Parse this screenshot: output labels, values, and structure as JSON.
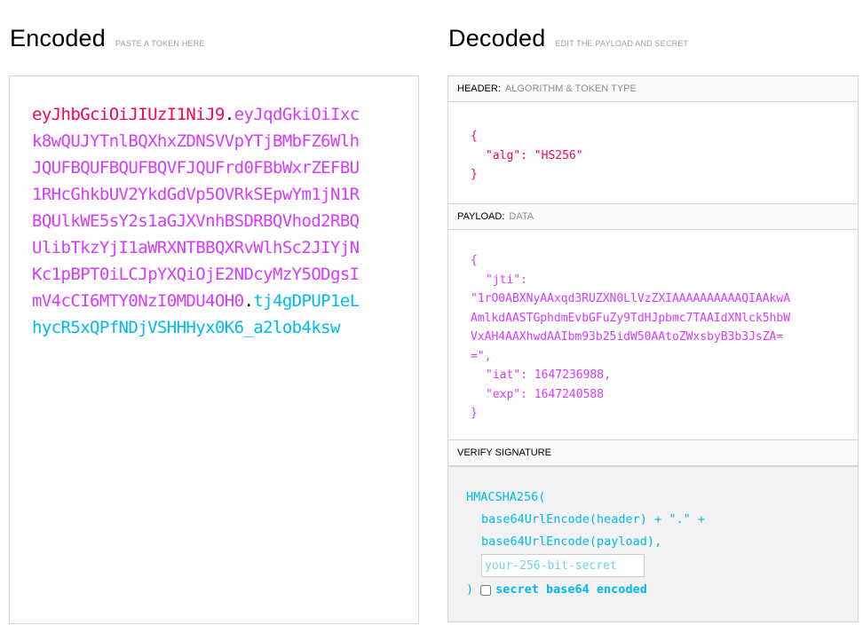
{
  "encoded": {
    "title": "Encoded",
    "hint": "PASTE A TOKEN HERE",
    "token_header": "eyJhbGciOiJIUzI1NiJ9",
    "token_payload": "eyJqdGkiOiIxck8wQUJYTnlBQXhxZDNSVVpYTjBMbFZ6WlhJQUFBQUFBQUFBQVFJQUFrd0FBbWxrZEFBU1RHcGhkbUV2YkdGdVp5OVRkSEpwYm1jN1RBQUlkWE5sY2s1aGJXVnhBSDRBQVhod2RBQUlibTkzYjI1aWRXNTBBQXRvWlhSc2JIYjNKc1pBPT0iLCJpYXQiOjE2NDcyMzY5ODgsImV4cCI6MTY0NzI0MDU4OH0",
    "token_signature": "tj4gDPUP1eLhycR5xQPfNDjVSHHHyx0K6_a2lob4ksw",
    "dot": "."
  },
  "decoded": {
    "title": "Decoded",
    "hint": "EDIT THE PAYLOAD AND SECRET",
    "header_section": {
      "label": "HEADER:",
      "sublabel": "ALGORITHM & TOKEN TYPE",
      "open": "{",
      "line1": "\"alg\": \"HS256\"",
      "close": "}"
    },
    "payload_section": {
      "label": "PAYLOAD:",
      "sublabel": "DATA",
      "open": "{",
      "jti_key": "\"jti\":",
      "jti_value": "\"1rO0ABXNyAAxqd3RUZXN0LlVzZXIAAAAAAAAAAQIAAkwAAmlkdAASTGphdmEvbGFuZy9TdHJpbmc7TAAIdXNlck5hbWVxAH4AAXhwdAAIbm93b25idW50AAtoZWxsbyB3b3JsZA==\",",
      "iat_key": "\"iat\":",
      "iat_value": "1647236988,",
      "exp_key": "\"exp\":",
      "exp_value": "1647240588",
      "close": "}"
    },
    "verify_section": {
      "label": "VERIFY SIGNATURE",
      "line1": "HMACSHA256(",
      "line2": "base64UrlEncode(header) + \".\" +",
      "line3": "base64UrlEncode(payload),",
      "secret_placeholder": "your-256-bit-secret",
      "close_paren": ")",
      "b64_label": "secret base64 encoded"
    }
  },
  "colors": {
    "header": "#fb015b",
    "payload": "#d63aff",
    "signature": "#00b9f1"
  }
}
